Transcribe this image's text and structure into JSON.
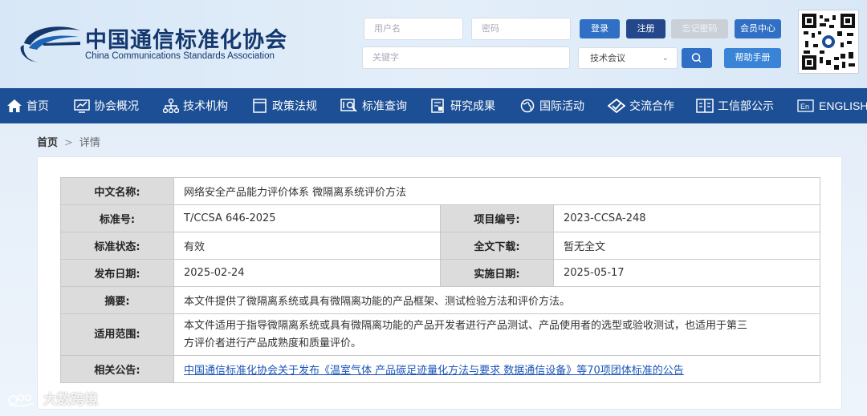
{
  "header": {
    "org_name_cn": "中国通信标准化协会",
    "org_name_en": "China Communications Standards Association",
    "username_placeholder": "用户名",
    "password_placeholder": "密码",
    "keyword_placeholder": "关键字",
    "login_label": "登录",
    "register_label": "注册",
    "forgot_label": "忘记密码",
    "member_center_label": "会员中心",
    "help_label": "帮助手册",
    "category_selected": "技术会议"
  },
  "nav": {
    "items": [
      {
        "label": "首页",
        "icon": "home-icon"
      },
      {
        "label": "协会概况",
        "icon": "chart-icon"
      },
      {
        "label": "技术机构",
        "icon": "org-tree-icon"
      },
      {
        "label": "政策法规",
        "icon": "document-icon"
      },
      {
        "label": "标准查询",
        "icon": "search-doc-icon"
      },
      {
        "label": "研究成果",
        "icon": "report-icon"
      },
      {
        "label": "国际活动",
        "icon": "globe-icon"
      },
      {
        "label": "交流合作",
        "icon": "handshake-icon"
      },
      {
        "label": "工信部公示",
        "icon": "board-icon"
      },
      {
        "label": "ENGLISH",
        "icon": "en-icon"
      }
    ]
  },
  "breadcrumb": {
    "home": "首页",
    "separator": ">",
    "current": "详情"
  },
  "detail": {
    "cn_name_label": "中文名称:",
    "cn_name": "网络安全产品能力评价体系 微隔离系统评价方法",
    "std_no_label": "标准号:",
    "std_no": "T/CCSA 646-2025",
    "project_no_label": "项目编号:",
    "project_no": "2023-CCSA-248",
    "status_label": "标准状态:",
    "status": "有效",
    "download_label": "全文下载:",
    "download": "暂无全文",
    "publish_label": "发布日期:",
    "publish_date": "2025-02-24",
    "implement_label": "实施日期:",
    "implement_date": "2025-05-17",
    "abstract_label": "摘要:",
    "abstract": "本文件提供了微隔离系统或具有微隔离功能的产品框架、测试检验方法和评价方法。",
    "scope_label": "适用范围:",
    "scope_line1": "本文件适用于指导微隔离系统或具有微隔离功能的产品开发者进行产品测试、产品使用者的选型或验收测试，也适用于第三",
    "scope_line2": "方评价者进行产品成熟度和质量评价。",
    "notice_label": "相关公告:",
    "notice": "中国通信标准化协会关于发布《温室气体 产品碳足迹量化方法与要求 数据通信设备》等70项团体标准的公告"
  },
  "watermark": "大数跨境",
  "colors": {
    "nav_bg": "#1c4f95",
    "label_bg": "#dcdcdc",
    "link": "#1b55b8",
    "button_blue": "#2f6fc4"
  }
}
